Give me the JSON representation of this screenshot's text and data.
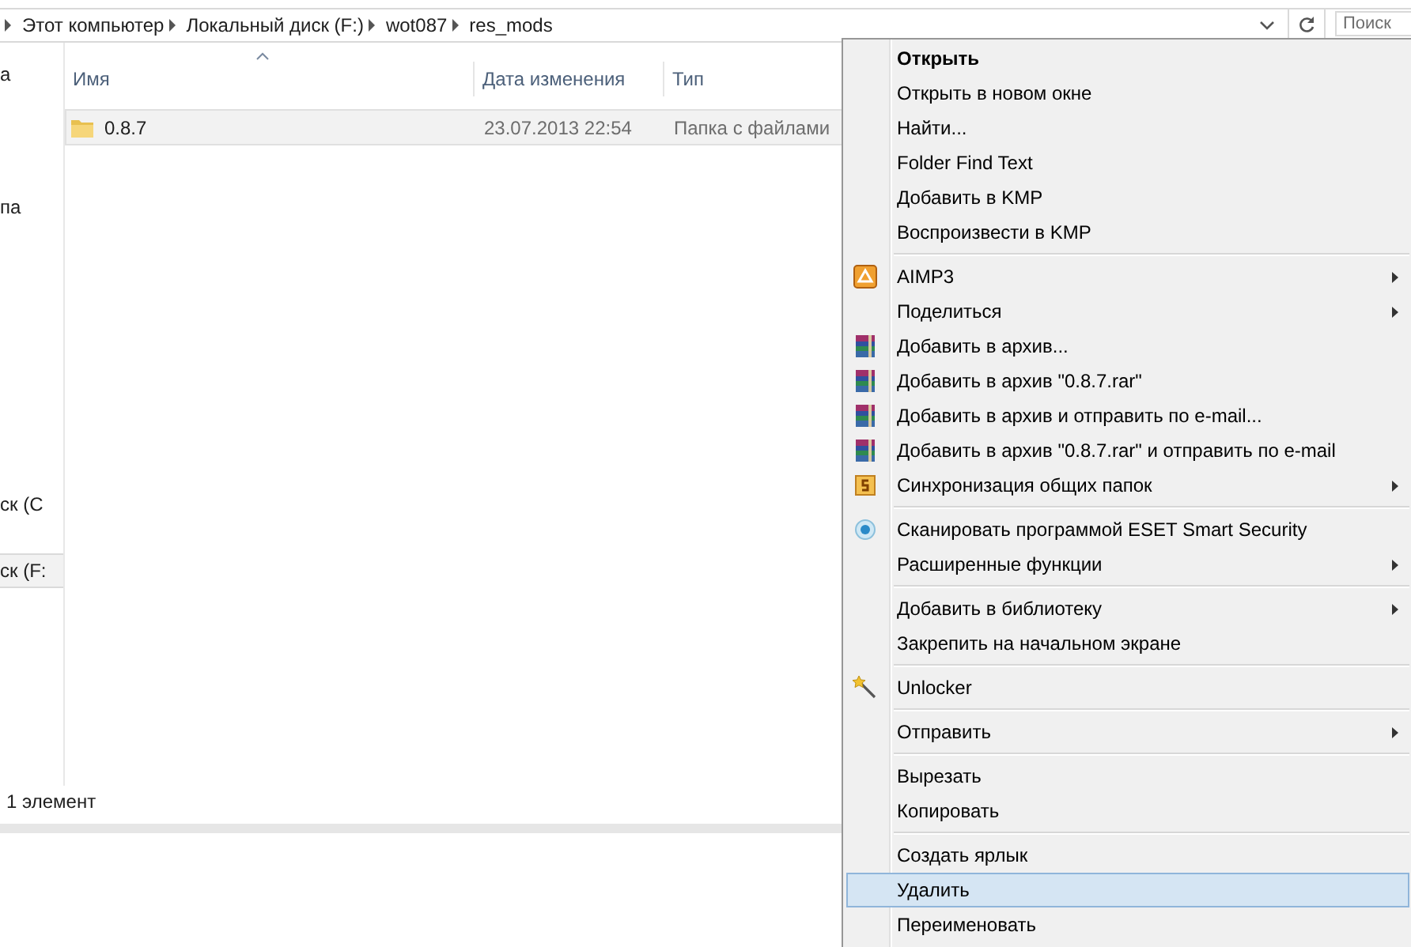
{
  "address_bar": {
    "breadcrumbs": [
      "Этот компьютер",
      "Локальный диск (F:)",
      "wot087",
      "res_mods"
    ],
    "search": {
      "placeholder": "Поиск"
    }
  },
  "sidebar": {
    "items": [
      {
        "label": "а",
        "selected": false
      },
      {
        "label": "па",
        "selected": false
      },
      {
        "label": "ск (C",
        "selected": false
      },
      {
        "label": "ск (F:",
        "selected": true
      }
    ]
  },
  "table": {
    "columns": [
      "Имя",
      "Дата изменения",
      "Тип"
    ],
    "rows": [
      {
        "name": "0.8.7",
        "date": "23.07.2013 22:54",
        "type": "Папка с файлами",
        "selected": true
      }
    ]
  },
  "status_bar": {
    "text": "1 элемент"
  },
  "context_menu": {
    "groups": [
      [
        {
          "label": "Открыть",
          "default": true,
          "submenu": false,
          "selected": false,
          "kind": "plain"
        },
        {
          "label": "Открыть в новом окне",
          "default": false,
          "submenu": false,
          "selected": false,
          "kind": "plain"
        },
        {
          "label": "Найти...",
          "default": false,
          "submenu": false,
          "selected": false,
          "kind": "plain"
        },
        {
          "label": "Folder Find Text",
          "default": false,
          "submenu": false,
          "selected": false,
          "kind": "plain"
        },
        {
          "label": "Добавить в KMP",
          "default": false,
          "submenu": false,
          "selected": false,
          "kind": "plain"
        },
        {
          "label": "Воспроизвести в KMP",
          "default": false,
          "submenu": false,
          "selected": false,
          "kind": "plain"
        }
      ],
      [
        {
          "label": "AIMP3",
          "default": false,
          "submenu": true,
          "selected": false,
          "kind": "player"
        },
        {
          "label": "Поделиться",
          "default": false,
          "submenu": true,
          "selected": false,
          "kind": "plain"
        },
        {
          "label": "Добавить в архив...",
          "default": false,
          "submenu": false,
          "selected": false,
          "kind": "archive"
        },
        {
          "label": "Добавить в архив \"0.8.7.rar\"",
          "default": false,
          "submenu": false,
          "selected": false,
          "kind": "archive"
        },
        {
          "label": "Добавить в архив и отправить по e-mail...",
          "default": false,
          "submenu": false,
          "selected": false,
          "kind": "archive"
        },
        {
          "label": "Добавить в архив \"0.8.7.rar\" и отправить по e-mail",
          "default": false,
          "submenu": false,
          "selected": false,
          "kind": "archive"
        },
        {
          "label": "Синхронизация общих папок",
          "default": false,
          "submenu": true,
          "selected": false,
          "kind": "sync"
        }
      ],
      [
        {
          "label": "Сканировать программой ESET Smart Security",
          "default": false,
          "submenu": false,
          "selected": false,
          "kind": "scan"
        },
        {
          "label": "Расширенные функции",
          "default": false,
          "submenu": true,
          "selected": false,
          "kind": "plain"
        }
      ],
      [
        {
          "label": "Добавить в библиотеку",
          "default": false,
          "submenu": true,
          "selected": false,
          "kind": "plain"
        },
        {
          "label": "Закрепить на начальном экране",
          "default": false,
          "submenu": false,
          "selected": false,
          "kind": "plain"
        }
      ],
      [
        {
          "label": "Unlocker",
          "default": false,
          "submenu": false,
          "selected": false,
          "kind": "wand"
        }
      ],
      [
        {
          "label": "Отправить",
          "default": false,
          "submenu": true,
          "selected": false,
          "kind": "plain"
        }
      ],
      [
        {
          "label": "Вырезать",
          "default": false,
          "submenu": false,
          "selected": false,
          "kind": "plain"
        },
        {
          "label": "Копировать",
          "default": false,
          "submenu": false,
          "selected": false,
          "kind": "plain"
        }
      ],
      [
        {
          "label": "Создать ярлык",
          "default": false,
          "submenu": false,
          "selected": false,
          "kind": "plain"
        },
        {
          "label": "Удалить",
          "default": false,
          "submenu": false,
          "selected": true,
          "kind": "plain"
        },
        {
          "label": "Переименовать",
          "default": false,
          "submenu": false,
          "selected": false,
          "kind": "plain"
        }
      ]
    ]
  }
}
